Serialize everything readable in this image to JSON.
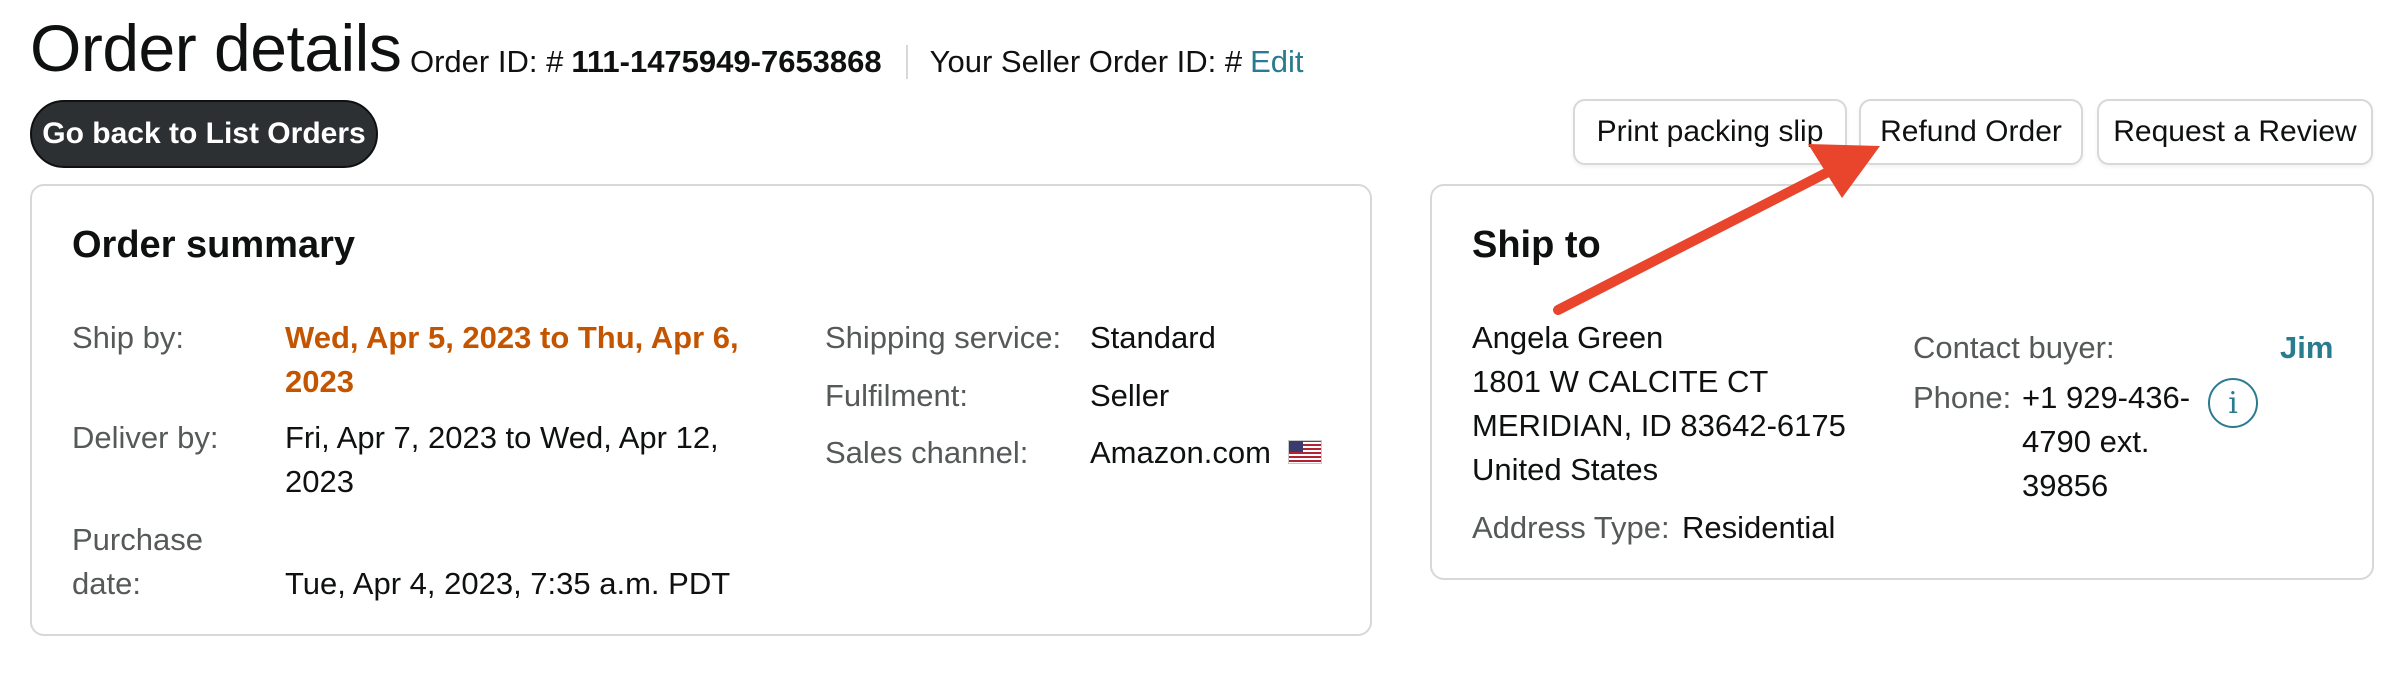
{
  "header": {
    "title": "Order details",
    "order_id_label": "Order ID: #",
    "order_id_value": "111-1475949-7653868",
    "seller_order_id_label": "Your Seller Order ID: #",
    "seller_order_id_edit": "Edit"
  },
  "buttons": {
    "back": "Go back to List Orders",
    "print_packing_slip": "Print packing slip",
    "refund_order": "Refund Order",
    "request_review": "Request a Review"
  },
  "order_summary": {
    "title": "Order summary",
    "ship_by_label": "Ship by:",
    "ship_by_line1": "Wed, Apr 5, 2023 to Thu, Apr 6,",
    "ship_by_line2": "2023",
    "deliver_by_label": "Deliver by:",
    "deliver_by_line1": "Fri, Apr 7, 2023 to Wed, Apr 12,",
    "deliver_by_line2": "2023",
    "purchase_date_label_line1": "Purchase",
    "purchase_date_label_line2": "date:",
    "purchase_date_value": "Tue, Apr 4, 2023, 7:35 a.m. PDT",
    "shipping_service_label": "Shipping service:",
    "shipping_service_value": "Standard",
    "fulfilment_label": "Fulfilment:",
    "fulfilment_value": "Seller",
    "sales_channel_label": "Sales channel:",
    "sales_channel_value": "Amazon.com",
    "sales_channel_icon": "us-flag-icon"
  },
  "ship_to": {
    "title": "Ship to",
    "name": "Angela Green",
    "address_line1": "1801 W CALCITE CT",
    "address_line2": "MERIDIAN, ID 83642-6175",
    "country": "United States",
    "address_type_label": "Address Type:",
    "address_type_value": "Residential",
    "contact_buyer_label": "Contact buyer:",
    "contact_buyer_value": "Jim",
    "phone_label": "Phone:",
    "phone_line1": "+1 929-436-",
    "phone_line2": "4790 ext.",
    "phone_line3": "39856",
    "info_icon_glyph": "i"
  },
  "colors": {
    "accent_teal": "#2a7b8f",
    "ship_by_orange": "#c45500",
    "annotation_red": "#e8452c",
    "dark_button": "#2d3032"
  }
}
